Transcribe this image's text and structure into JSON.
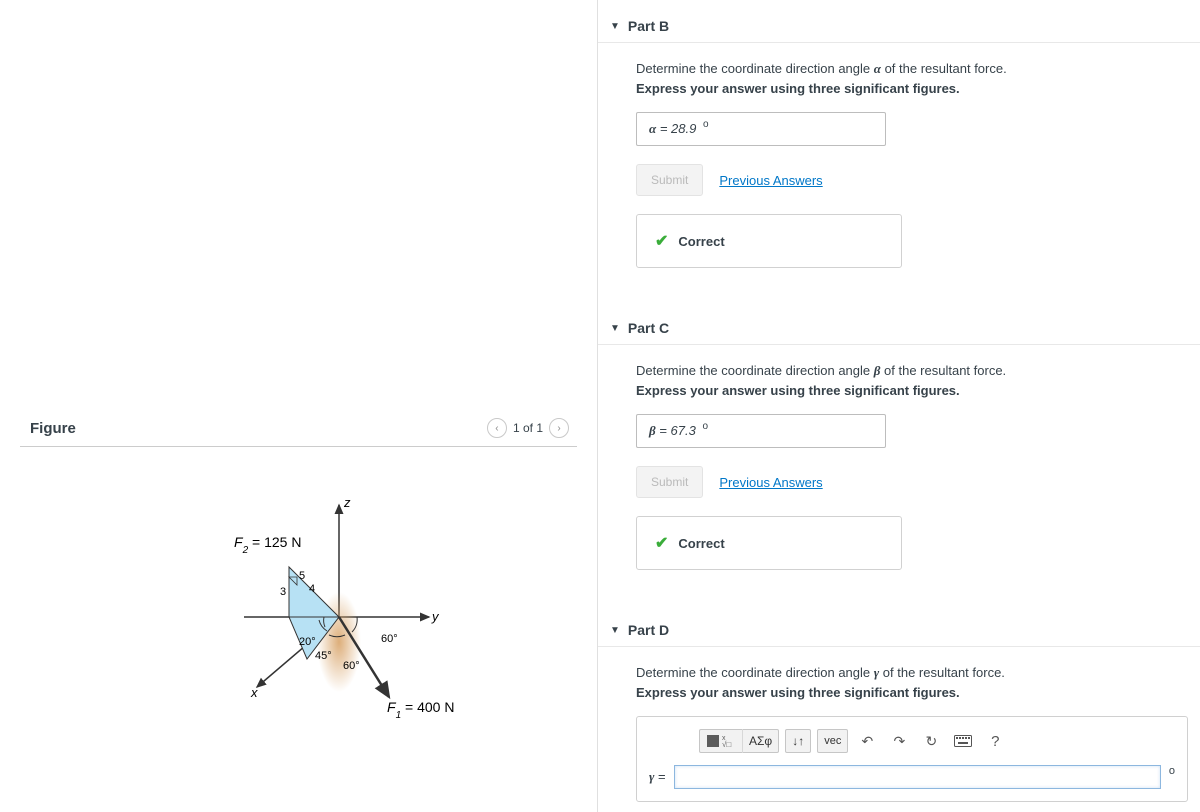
{
  "figure": {
    "title": "Figure",
    "pager": "1 of 1",
    "labels": {
      "z": "z",
      "y": "y",
      "x": "x",
      "f2": "F",
      "f2sub": "2",
      "f2text": " = 125 N",
      "f1": "F",
      "f1sub": "1",
      "f1text": " = 400 N",
      "a3": "3",
      "a4": "4",
      "a5": "5",
      "ang20": "20°",
      "ang45": "45°",
      "ang60a": "60°",
      "ang60b": "60°"
    }
  },
  "partB": {
    "header": "Part B",
    "prompt_pre": "Determine the coordinate direction angle ",
    "prompt_var": "α",
    "prompt_post": " of the resultant force.",
    "hint": "Express your answer using three significant figures.",
    "ans_var": "α",
    "ans_eq": " = ",
    "ans_val": "28.9",
    "ans_unit": "o",
    "submit": "Submit",
    "prev": "Previous Answers",
    "fb": "Correct"
  },
  "partC": {
    "header": "Part C",
    "prompt_pre": "Determine the coordinate direction angle ",
    "prompt_var": "β",
    "prompt_post": " of the resultant force.",
    "hint": "Express your answer using three significant figures.",
    "ans_var": "β",
    "ans_eq": " = ",
    "ans_val": "67.3",
    "ans_unit": "o",
    "submit": "Submit",
    "prev": "Previous Answers",
    "fb": "Correct"
  },
  "partD": {
    "header": "Part D",
    "prompt_pre": "Determine the coordinate direction angle ",
    "prompt_var": "γ",
    "prompt_post": " of the resultant force.",
    "hint": "Express your answer using three significant figures.",
    "toolbar": {
      "sigma": "ΑΣφ",
      "arrows": "↓↑",
      "vec": "vec",
      "help": "?"
    },
    "ans_var": "γ",
    "ans_eq": " = ",
    "ans_unit": "o"
  }
}
